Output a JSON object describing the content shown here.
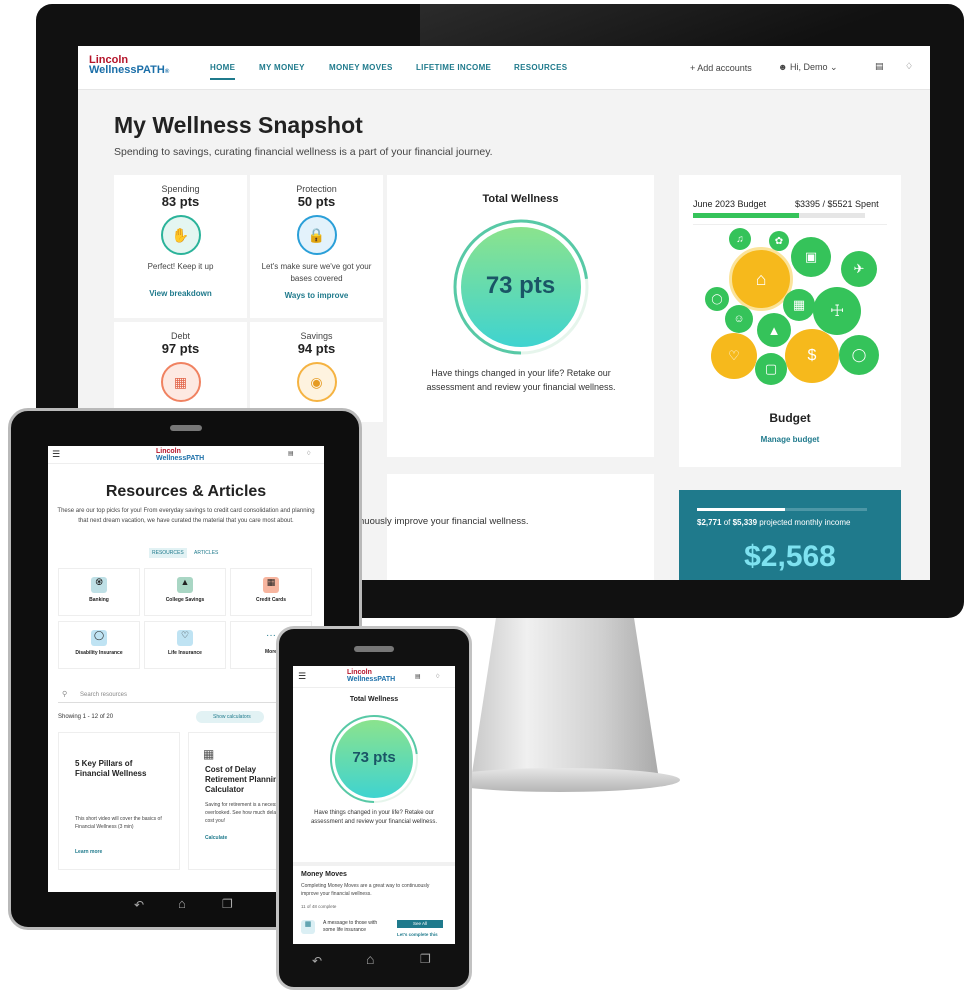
{
  "brand": {
    "line1": "Lincoln",
    "line2a": "Wellness",
    "line2b": "PATH",
    "tm": "®"
  },
  "desktop": {
    "nav": {
      "items": [
        "HOME",
        "MY MONEY",
        "MONEY MOVES",
        "LIFETIME INCOME",
        "RESOURCES"
      ],
      "add_accounts": "Add accounts",
      "greeting": "Hi, Demo"
    },
    "title": "My Wellness Snapshot",
    "subtitle": "Spending to savings, curating financial wellness is a part of your financial journey.",
    "scores": [
      {
        "label": "Spending",
        "pts": "83 pts",
        "desc": "Perfect! Keep it up",
        "link": "View breakdown",
        "color": "#2bb39a"
      },
      {
        "label": "Protection",
        "pts": "50 pts",
        "desc": "Let's make sure we've got your bases covered",
        "link": "Ways to improve",
        "color": "#2a9fd8"
      },
      {
        "label": "Debt",
        "pts": "97 pts",
        "color": "#f08261"
      },
      {
        "label": "Savings",
        "pts": "94 pts",
        "color": "#f5b342"
      }
    ],
    "total": {
      "title": "Total Wellness",
      "pts": "73 pts",
      "desc": "Have things changed in your life? Retake our assessment and review your financial wellness.",
      "value": 73
    },
    "budget": {
      "label": "June 2023 Budget",
      "spent": "$3395 / $5521 Spent",
      "fraction": 0.615,
      "title": "Budget",
      "link": "Manage budget"
    },
    "income": {
      "text_a": "$2,771",
      "text_b": " of ",
      "text_c": "$5,339",
      "text_d": " projected monthly income",
      "amount": "$2,568",
      "fraction": 0.52
    },
    "moves_text": "nuously improve your financial wellness."
  },
  "tablet": {
    "title": "Resources & Articles",
    "intro": "These are our top picks for you! From everyday savings to credit card consolidation and planning that next dream vacation, we have curated the material that you care most about.",
    "tabs": [
      "RESOURCES",
      "ARTICLES"
    ],
    "categories": [
      "Banking",
      "College Savings",
      "Credit Cards",
      "Disability Insurance",
      "Life Insurance",
      "More"
    ],
    "search_placeholder": "Search resources",
    "showing": "Showing 1 - 12 of 20",
    "show_calc": "Show calculators",
    "articles": [
      {
        "title": "5 Key Pillars of Financial Wellness",
        "desc": "This short video will cover the basics of Financial Wellness (3 min)",
        "link": "Learn more"
      },
      {
        "title": "Cost of Delay Retirement Planning Calculator",
        "desc": "Saving for retirement is a necessity often overlooked. See how much delaying may cost you!",
        "link": "Calculate"
      }
    ]
  },
  "phone": {
    "title": "Total Wellness",
    "pts": "73 pts",
    "desc": "Have things changed in your life? Retake our assessment and review your financial wellness.",
    "moves_title": "Money Moves",
    "moves_desc": "Completing Money Moves are a great way to continuously improve your financial wellness.",
    "moves_count": "11 of 48 complete",
    "msg": "A message to those with some life insurance",
    "msg_btn": "See All",
    "msg_link": "Let's complete this"
  }
}
